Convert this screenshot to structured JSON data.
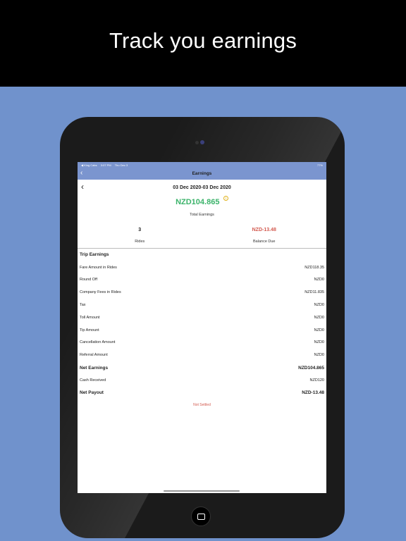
{
  "banner": {
    "title": "Track you earnings"
  },
  "status_bar": {
    "carrier": "◀ King Cabs",
    "time": "3:07 PM",
    "date": "Thu Dec 3",
    "battery": "77%"
  },
  "navbar": {
    "title": "Earnings"
  },
  "summary": {
    "date_range": "03 Dec 2020-03 Dec 2020",
    "total_amount": "NZD104.865",
    "total_label": "Total Earnings",
    "rides_value": "3",
    "rides_label": "Rides",
    "balance_value": "NZD-13.48",
    "balance_label": "Balance Due"
  },
  "rows": [
    {
      "label": "Trip Earnings",
      "value": ""
    },
    {
      "label": "Fare Amount in Rides",
      "value": "NZD118.35"
    },
    {
      "label": "Round Off",
      "value": "NZD0"
    },
    {
      "label": "Company Fees in Rides",
      "value": "NZD11.835"
    },
    {
      "label": "Tax",
      "value": "NZD0"
    },
    {
      "label": "Toll Amount",
      "value": "NZD0"
    },
    {
      "label": "Tip Amount",
      "value": "NZD0"
    },
    {
      "label": "Cancellation Amount",
      "value": "NZD0"
    },
    {
      "label": "Referral Amount",
      "value": "NZD0"
    },
    {
      "label": "Net Earnings",
      "value": "NZD104.865"
    },
    {
      "label": "Cash Received",
      "value": "NZD120"
    },
    {
      "label": "Net Payout",
      "value": "NZD-13.48"
    }
  ],
  "settlement_status": "Not Settled",
  "colors": {
    "background": "#7092cc",
    "accent_green": "#3bb36a",
    "accent_red": "#d35a4f",
    "navbar": "#7b95cf"
  },
  "icons": {
    "back": "chevron-left-icon",
    "info": "info-icon",
    "home": "home-button-icon"
  }
}
